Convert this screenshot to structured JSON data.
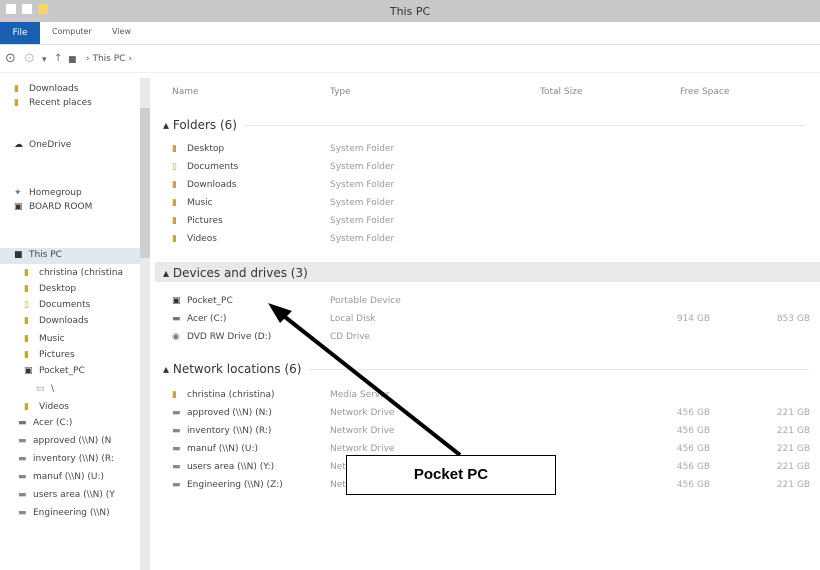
{
  "window": {
    "title": "This PC"
  },
  "ribbon": {
    "file_label": "File",
    "tabs": [
      "Computer",
      "View"
    ]
  },
  "address": {
    "path": "This PC",
    "separator": "›"
  },
  "columns": {
    "name": "Name",
    "type": "Type",
    "total_size": "Total Size",
    "free_space": "Free Space"
  },
  "sidebar": {
    "items": [
      {
        "label": "Downloads",
        "icon": "downloads-folder-icon"
      },
      {
        "label": "Recent places",
        "icon": "recent-places-icon"
      },
      {
        "label": "OneDrive",
        "icon": "onedrive-icon"
      },
      {
        "label": "Homegroup",
        "icon": "homegroup-icon"
      },
      {
        "label": "BOARD ROOM",
        "icon": "user-icon"
      },
      {
        "label": "This PC",
        "icon": "this-pc-icon"
      },
      {
        "label": "christina (christina",
        "icon": "media-device-icon"
      },
      {
        "label": "Desktop",
        "icon": "folder-icon"
      },
      {
        "label": "Documents",
        "icon": "folder-icon"
      },
      {
        "label": "Downloads",
        "icon": "folder-icon"
      },
      {
        "label": "Music",
        "icon": "folder-icon"
      },
      {
        "label": "Pictures",
        "icon": "folder-icon"
      },
      {
        "label": "Pocket_PC",
        "icon": "device-icon"
      },
      {
        "label": "\\",
        "icon": "storage-icon"
      },
      {
        "label": "Videos",
        "icon": "folder-icon"
      },
      {
        "label": "Acer (C:)",
        "icon": "drive-icon"
      },
      {
        "label": "approved (\\\\N) (N",
        "icon": "network-drive-icon"
      },
      {
        "label": "inventory (\\\\N) (R:",
        "icon": "network-drive-icon"
      },
      {
        "label": "manuf (\\\\N) (U:)",
        "icon": "network-drive-icon"
      },
      {
        "label": "users area (\\\\N) (Y",
        "icon": "network-drive-icon"
      },
      {
        "label": "Engineering (\\\\N)",
        "icon": "network-drive-icon"
      }
    ]
  },
  "groups": [
    {
      "label": "Folders (6)",
      "items": [
        {
          "name": "Desktop",
          "type": "System Folder",
          "icon": "desktop-folder-icon"
        },
        {
          "name": "Documents",
          "type": "System Folder",
          "icon": "documents-folder-icon"
        },
        {
          "name": "Downloads",
          "type": "System Folder",
          "icon": "downloads-folder-icon"
        },
        {
          "name": "Music",
          "type": "System Folder",
          "icon": "music-folder-icon"
        },
        {
          "name": "Pictures",
          "type": "System Folder",
          "icon": "pictures-folder-icon"
        },
        {
          "name": "Videos",
          "type": "System Folder",
          "icon": "videos-folder-icon"
        }
      ]
    },
    {
      "label": "Devices and drives (3)",
      "items": [
        {
          "name": "Pocket_PC",
          "type": "Portable Device",
          "total": "",
          "free": "",
          "icon": "pocket-pc-icon"
        },
        {
          "name": "Acer (C:)",
          "type": "Local Disk",
          "total": "914 GB",
          "free": "853 GB",
          "icon": "local-disk-icon"
        },
        {
          "name": "DVD RW Drive (D:)",
          "type": "CD Drive",
          "total": "",
          "free": "",
          "icon": "dvd-drive-icon"
        }
      ]
    },
    {
      "label": "Network locations (6)",
      "items": [
        {
          "name": "christina (christina)",
          "type": "Media Server",
          "total": "",
          "free": "",
          "icon": "media-server-icon"
        },
        {
          "name": "approved (\\\\N) (N:)",
          "type": "Network Drive",
          "total": "456 GB",
          "free": "221 GB",
          "icon": "network-drive-icon"
        },
        {
          "name": "inventory (\\\\N) (R:)",
          "type": "Network Drive",
          "total": "456 GB",
          "free": "221 GB",
          "icon": "network-drive-icon"
        },
        {
          "name": "manuf (\\\\N) (U:)",
          "type": "Network Drive",
          "total": "456 GB",
          "free": "221 GB",
          "icon": "network-drive-icon"
        },
        {
          "name": "users area (\\\\N) (Y:)",
          "type": "Network Drive",
          "total": "456 GB",
          "free": "221 GB",
          "icon": "network-drive-icon"
        },
        {
          "name": "Engineering (\\\\N) (Z:)",
          "type": "Network Drive",
          "total": "456 GB",
          "free": "221 GB",
          "icon": "network-drive-icon"
        }
      ]
    }
  ],
  "callout": {
    "label": "Pocket PC"
  },
  "colors": {
    "file_tab": "#1a5fb0",
    "group_highlight": "#e9e9e9",
    "selection": "#dfe7f0"
  }
}
